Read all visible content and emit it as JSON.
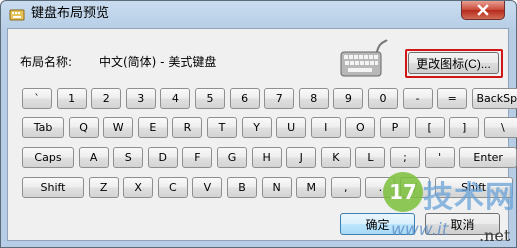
{
  "window": {
    "title": "键盘布局预览"
  },
  "layout": {
    "label": "布局名称:",
    "value": "中文(简体) - 美式键盘"
  },
  "change_icon_button": "更改图标(C)...",
  "keyboard": {
    "rows": [
      [
        "`",
        "1",
        "2",
        "3",
        "4",
        "5",
        "6",
        "7",
        "8",
        "9",
        "0",
        "-",
        "=",
        "BackSp"
      ],
      [
        "Tab",
        "Q",
        "W",
        "E",
        "R",
        "T",
        "Y",
        "U",
        "I",
        "O",
        "P",
        "[",
        "]",
        "\\"
      ],
      [
        "Caps",
        "A",
        "S",
        "D",
        "F",
        "G",
        "H",
        "J",
        "K",
        "L",
        ";",
        "'",
        "Enter"
      ],
      [
        "Shift",
        "Z",
        "X",
        "C",
        "V",
        "B",
        "N",
        "M",
        ",",
        ".",
        "/",
        "Shift"
      ]
    ]
  },
  "buttons": {
    "ok": "确定",
    "cancel": "取消"
  },
  "watermark": {
    "badge": "17",
    "text": "技术网",
    "site": "www.it",
    "suffix": ".net"
  },
  "colors": {
    "highlight": "#d01616",
    "close": "#c9483a"
  }
}
